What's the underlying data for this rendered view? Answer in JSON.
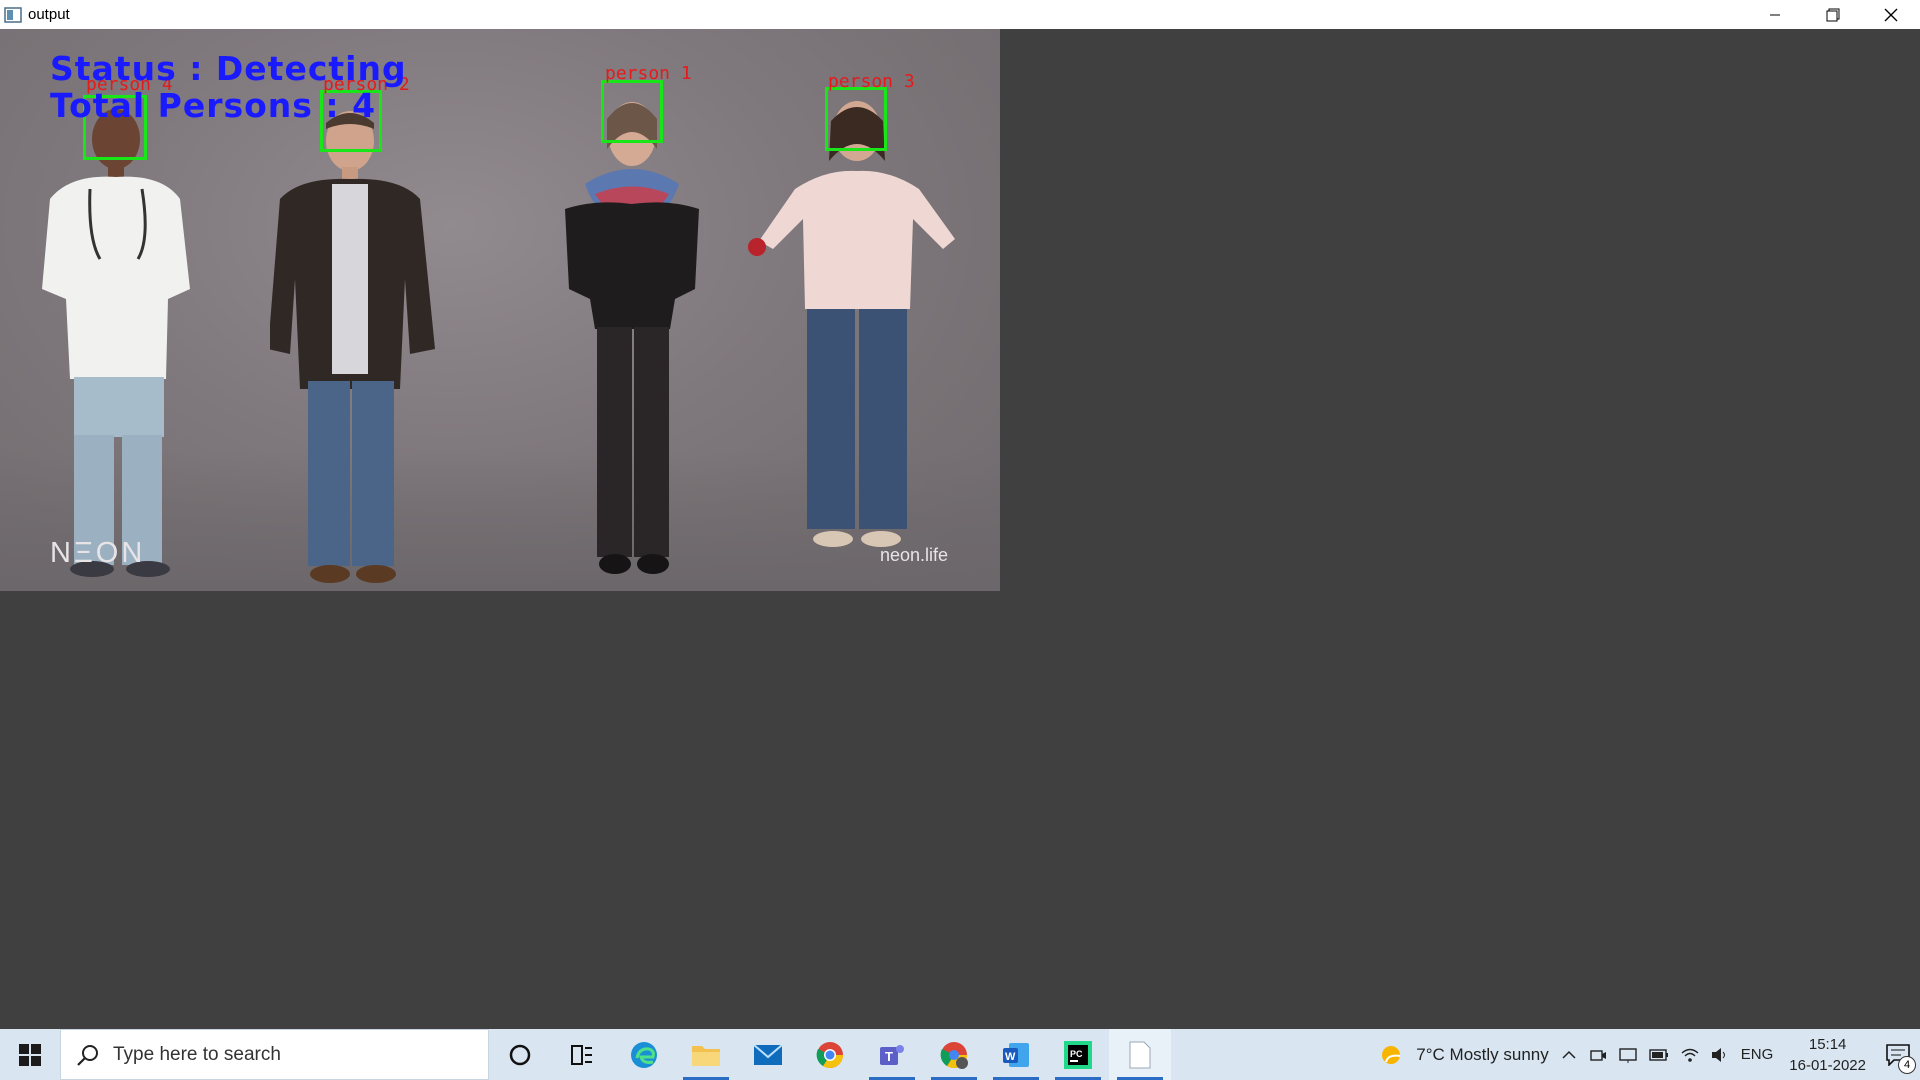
{
  "window": {
    "title": "output"
  },
  "overlay": {
    "status_line": "Status : Detecting",
    "count_line": "Total Persons : 4"
  },
  "detections": [
    {
      "label": "person 4"
    },
    {
      "label": "person 2"
    },
    {
      "label": "person 1"
    },
    {
      "label": "person 3"
    }
  ],
  "watermarks": {
    "left": "NΞON",
    "right": "neon.life"
  },
  "taskbar": {
    "search_placeholder": "Type here to search",
    "weather": "7°C  Mostly sunny",
    "language": "ENG",
    "time": "15:14",
    "date": "16-01-2022",
    "notifications": "4"
  },
  "colors": {
    "box": "#19e619",
    "label": "#e51b1b",
    "overlay": "#1a1aff"
  }
}
